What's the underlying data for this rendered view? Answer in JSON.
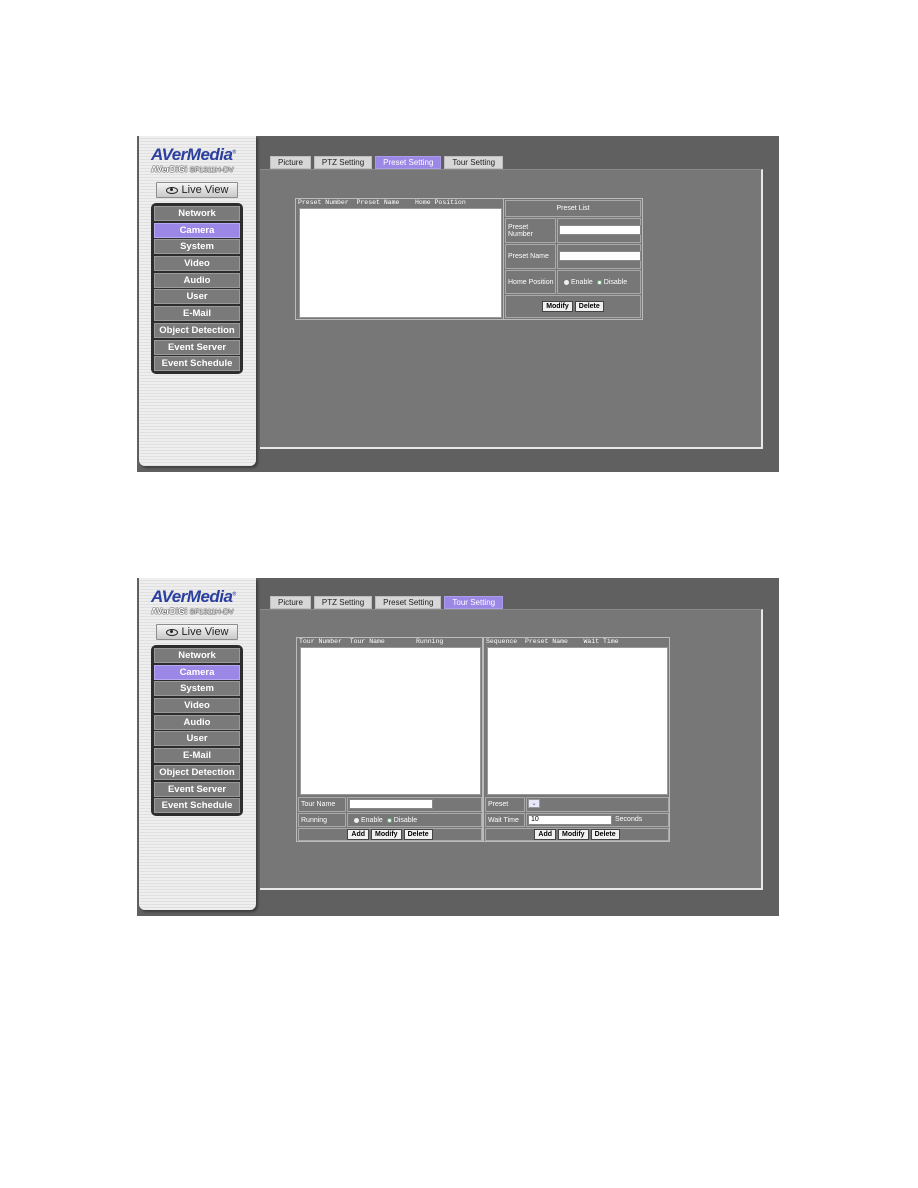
{
  "brand": {
    "logo": "AVerMedia",
    "product": "AVerDiGi",
    "model": "SF1311H-DV",
    "live_view_label": "Live View"
  },
  "sidebar": {
    "items": [
      {
        "label": "Network",
        "active": false
      },
      {
        "label": "Camera",
        "active": true
      },
      {
        "label": "System",
        "active": false
      },
      {
        "label": "Video",
        "active": false
      },
      {
        "label": "Audio",
        "active": false
      },
      {
        "label": "User",
        "active": false
      },
      {
        "label": "E-Mail",
        "active": false
      },
      {
        "label": "Object Detection",
        "active": false
      },
      {
        "label": "Event Server",
        "active": false
      },
      {
        "label": "Event Schedule",
        "active": false
      }
    ]
  },
  "tabs": [
    "Picture",
    "PTZ Setting",
    "Preset Setting",
    "Tour Setting"
  ],
  "colors": {
    "accent": "#9b87e6",
    "background": "#606060",
    "panel": "#777777"
  },
  "preset_screen": {
    "active_tab": "Preset Setting",
    "list_headers": "Preset Number  Preset Name    Home Position",
    "panel_title": "Preset List",
    "preset_number_label": "Preset Number",
    "preset_number_value": "",
    "preset_name_label": "Preset Name",
    "preset_name_value": "",
    "home_position_label": "Home Position",
    "enable_label": "Enable",
    "disable_label": "Disable",
    "home_position_selected": "Disable",
    "modify_label": "Modify",
    "delete_label": "Delete"
  },
  "tour_screen": {
    "active_tab": "Tour Setting",
    "tour_list_headers": "Tour Number  Tour Name        Running",
    "sequence_list_headers": "Sequence  Preset Name    Wait Time",
    "tour_name_label": "Tour Name",
    "tour_name_value": "",
    "running_label": "Running",
    "enable_label": "Enable",
    "disable_label": "Disable",
    "running_selected": "Disable",
    "preset_label": "Preset",
    "preset_selected": "",
    "wait_time_label": "Wait Time",
    "wait_time_value": "10",
    "wait_time_unit": "Seconds",
    "add_label": "Add",
    "modify_label": "Modify",
    "delete_label": "Delete"
  }
}
